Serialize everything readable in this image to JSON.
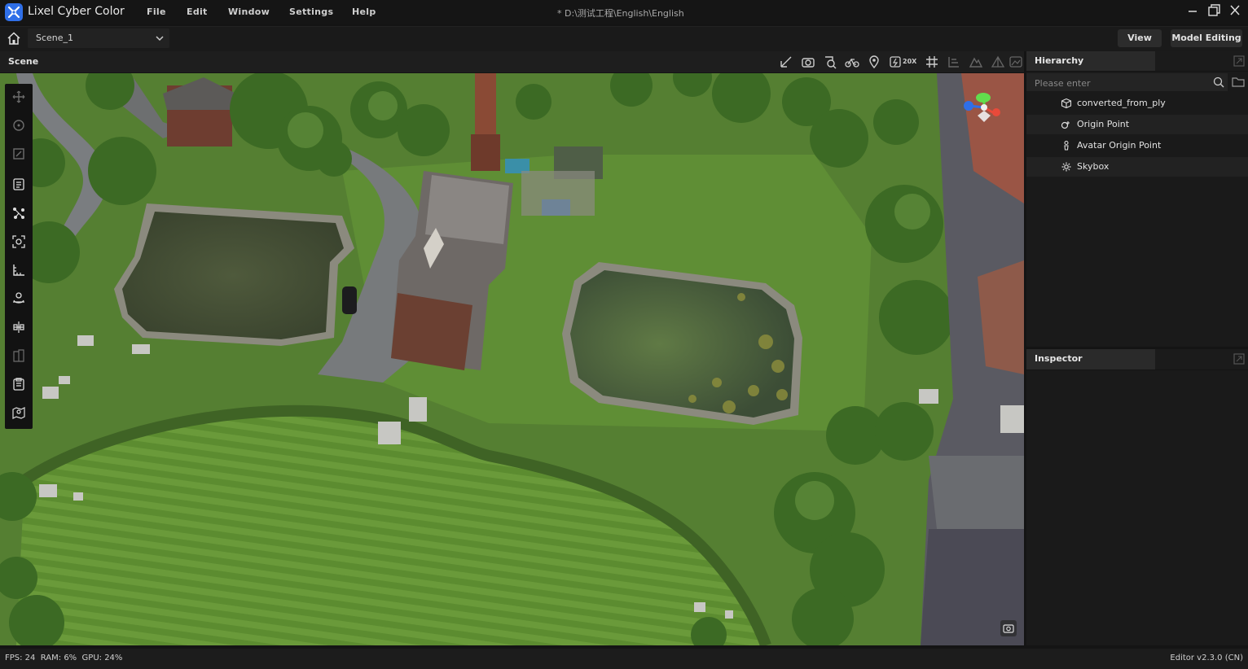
{
  "app": {
    "name": "Lixel Cyber Color",
    "logo_icon": "lixel-logo-icon"
  },
  "menu": {
    "items": [
      "File",
      "Edit",
      "Window",
      "Settings",
      "Help"
    ]
  },
  "window": {
    "title": "* D:\\测试工程\\English\\English"
  },
  "toolbar": {
    "scene_select": "Scene_1",
    "view_button": "View",
    "model_editing_button": "Model Editing"
  },
  "scene": {
    "title": "Scene",
    "toolbar_icons": [
      "measure-icon",
      "camera-icon",
      "search-object-icon",
      "bicycle-icon",
      "location-pin-icon",
      "speed-icon",
      "grid-icon",
      "align-icon",
      "terrain-icon",
      "triangle-icon",
      "image-icon"
    ],
    "speed_label": "20X",
    "tools": [
      "move-icon",
      "rotate-icon",
      "scale-icon",
      "annotation-icon",
      "path-icon",
      "focus-icon",
      "ruler-icon",
      "character-icon",
      "balance-icon",
      "split-icon",
      "clipboard-icon",
      "map-pin-icon"
    ]
  },
  "hierarchy": {
    "title": "Hierarchy",
    "search_placeholder": "Please enter",
    "items": [
      {
        "label": "converted_from_ply",
        "icon": "cube-icon"
      },
      {
        "label": "Origin Point",
        "icon": "origin-icon"
      },
      {
        "label": "Avatar Origin Point",
        "icon": "avatar-icon"
      },
      {
        "label": "Skybox",
        "icon": "gear-icon"
      }
    ]
  },
  "inspector": {
    "title": "Inspector"
  },
  "status": {
    "left": "FPS: 24  RAM: 6%  GPU: 24%",
    "right": "Editor v2.3.0 (CN)"
  }
}
